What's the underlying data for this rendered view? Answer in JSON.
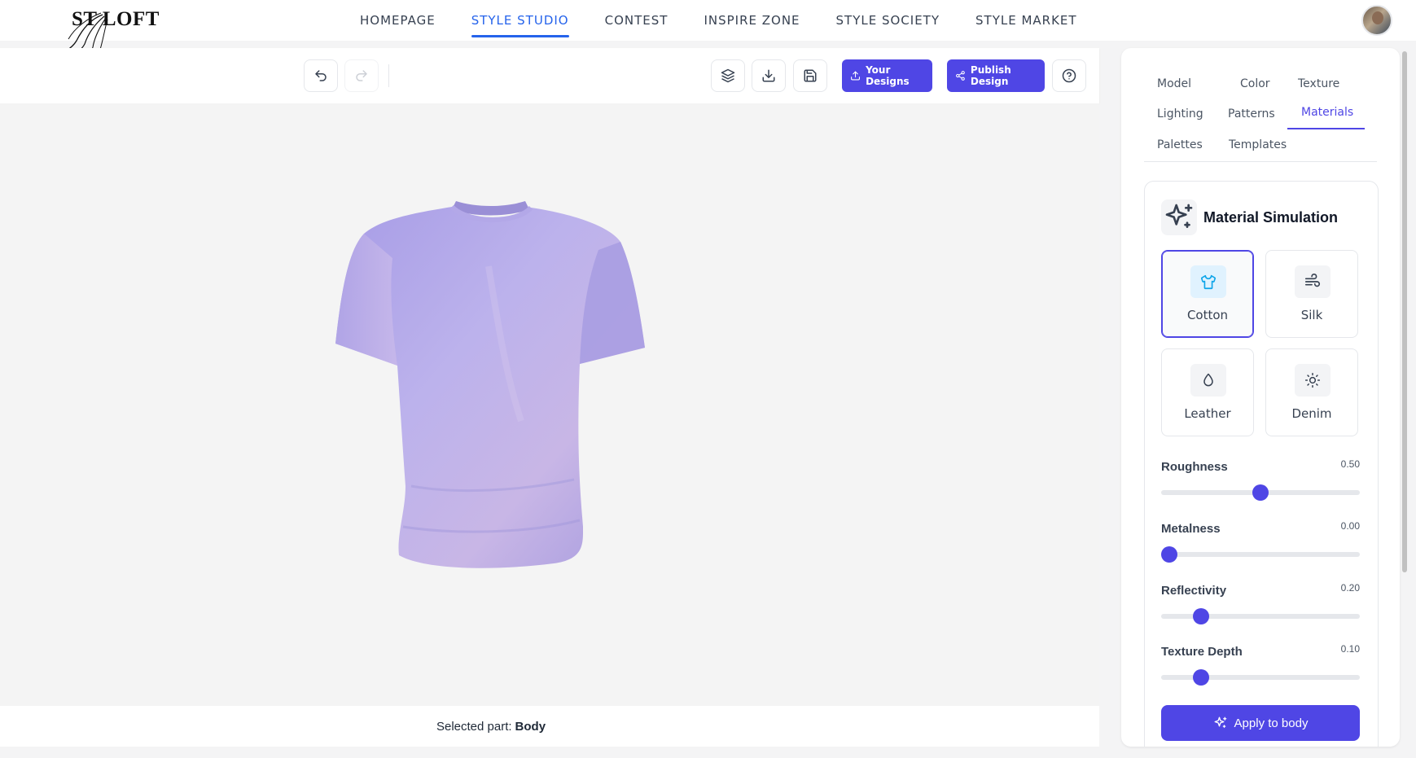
{
  "brand": {
    "logo_text": "ST LOFT"
  },
  "nav": {
    "items": [
      {
        "label": "HOMEPAGE"
      },
      {
        "label": "STYLE STUDIO"
      },
      {
        "label": "CONTEST"
      },
      {
        "label": "INSPIRE ZONE"
      },
      {
        "label": "STYLE SOCIETY"
      },
      {
        "label": "STYLE MARKET"
      }
    ],
    "active": "STYLE STUDIO"
  },
  "toolbar": {
    "your_designs": "Your Designs",
    "publish_design": "Publish Design",
    "icons": [
      "undo-icon",
      "redo-icon",
      "layers-icon",
      "download-icon",
      "save-icon",
      "upload-icon",
      "share-icon",
      "help-icon"
    ]
  },
  "viewer": {
    "selected_label": "Selected part:",
    "selected_value": "Body",
    "garment_color": "#b8aee8"
  },
  "panel": {
    "tabs": [
      "Model",
      "Color",
      "Texture",
      "Lighting",
      "Patterns",
      "Materials",
      "Palettes",
      "Templates"
    ],
    "active_tab": "Materials",
    "section_title": "Material Simulation",
    "materials": [
      {
        "label": "Cotton",
        "icon": "shirt-icon",
        "selected": true
      },
      {
        "label": "Silk",
        "icon": "wind-icon",
        "selected": false
      },
      {
        "label": "Leather",
        "icon": "droplet-icon",
        "selected": false
      },
      {
        "label": "Denim",
        "icon": "sun-icon",
        "selected": false
      }
    ],
    "sliders": [
      {
        "label": "Roughness",
        "value": "0.50",
        "level": 0.5
      },
      {
        "label": "Metalness",
        "value": "0.00",
        "level": 0.0
      },
      {
        "label": "Reflectivity",
        "value": "0.20",
        "level": 0.2
      },
      {
        "label": "Texture Depth",
        "value": "0.10",
        "level": 0.2
      }
    ],
    "apply_label": "Apply to body"
  },
  "colors": {
    "accent": "#4f46e5",
    "nav_active": "#2563eb"
  }
}
